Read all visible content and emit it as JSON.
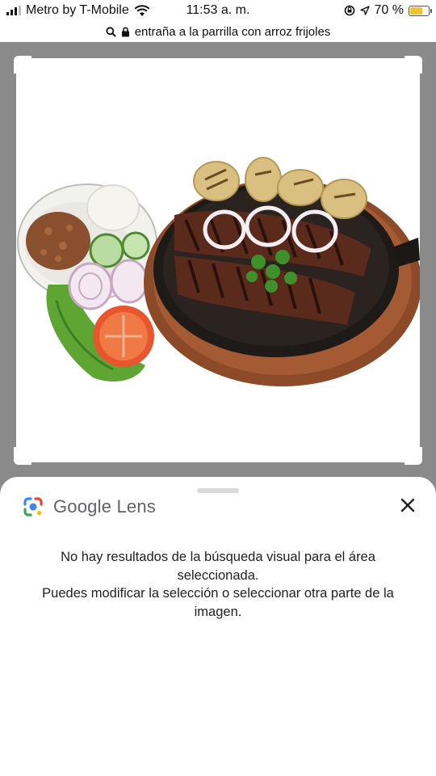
{
  "status_bar": {
    "carrier": "Metro by T-Mobile",
    "time": "11:53 a. m.",
    "battery": "70 %",
    "battery_level": 0.7,
    "icons": [
      "signal-icon",
      "wifi-icon",
      "screen-lock-icon",
      "location-arrow-icon",
      "battery-icon"
    ]
  },
  "url_bar": {
    "query": "entraña a la parrilla con arroz frijoles",
    "icons": [
      "search-icon",
      "lock-icon"
    ]
  },
  "lens_sheet": {
    "brand": "Google Lens",
    "message_line1": "No hay resultados de la búsqueda visual para el área seleccionada.",
    "message_line2": "Puedes modificar la selección o seleccionar otra parte de la imagen.",
    "close_icon": "close-icon"
  },
  "colors": {
    "viewer_background": "#8a8a8a",
    "battery_fill": "#f2c230",
    "lens_blue": "#4285f4",
    "lens_red": "#ea4335",
    "lens_yellow": "#fbbc05",
    "lens_green": "#34a853"
  }
}
